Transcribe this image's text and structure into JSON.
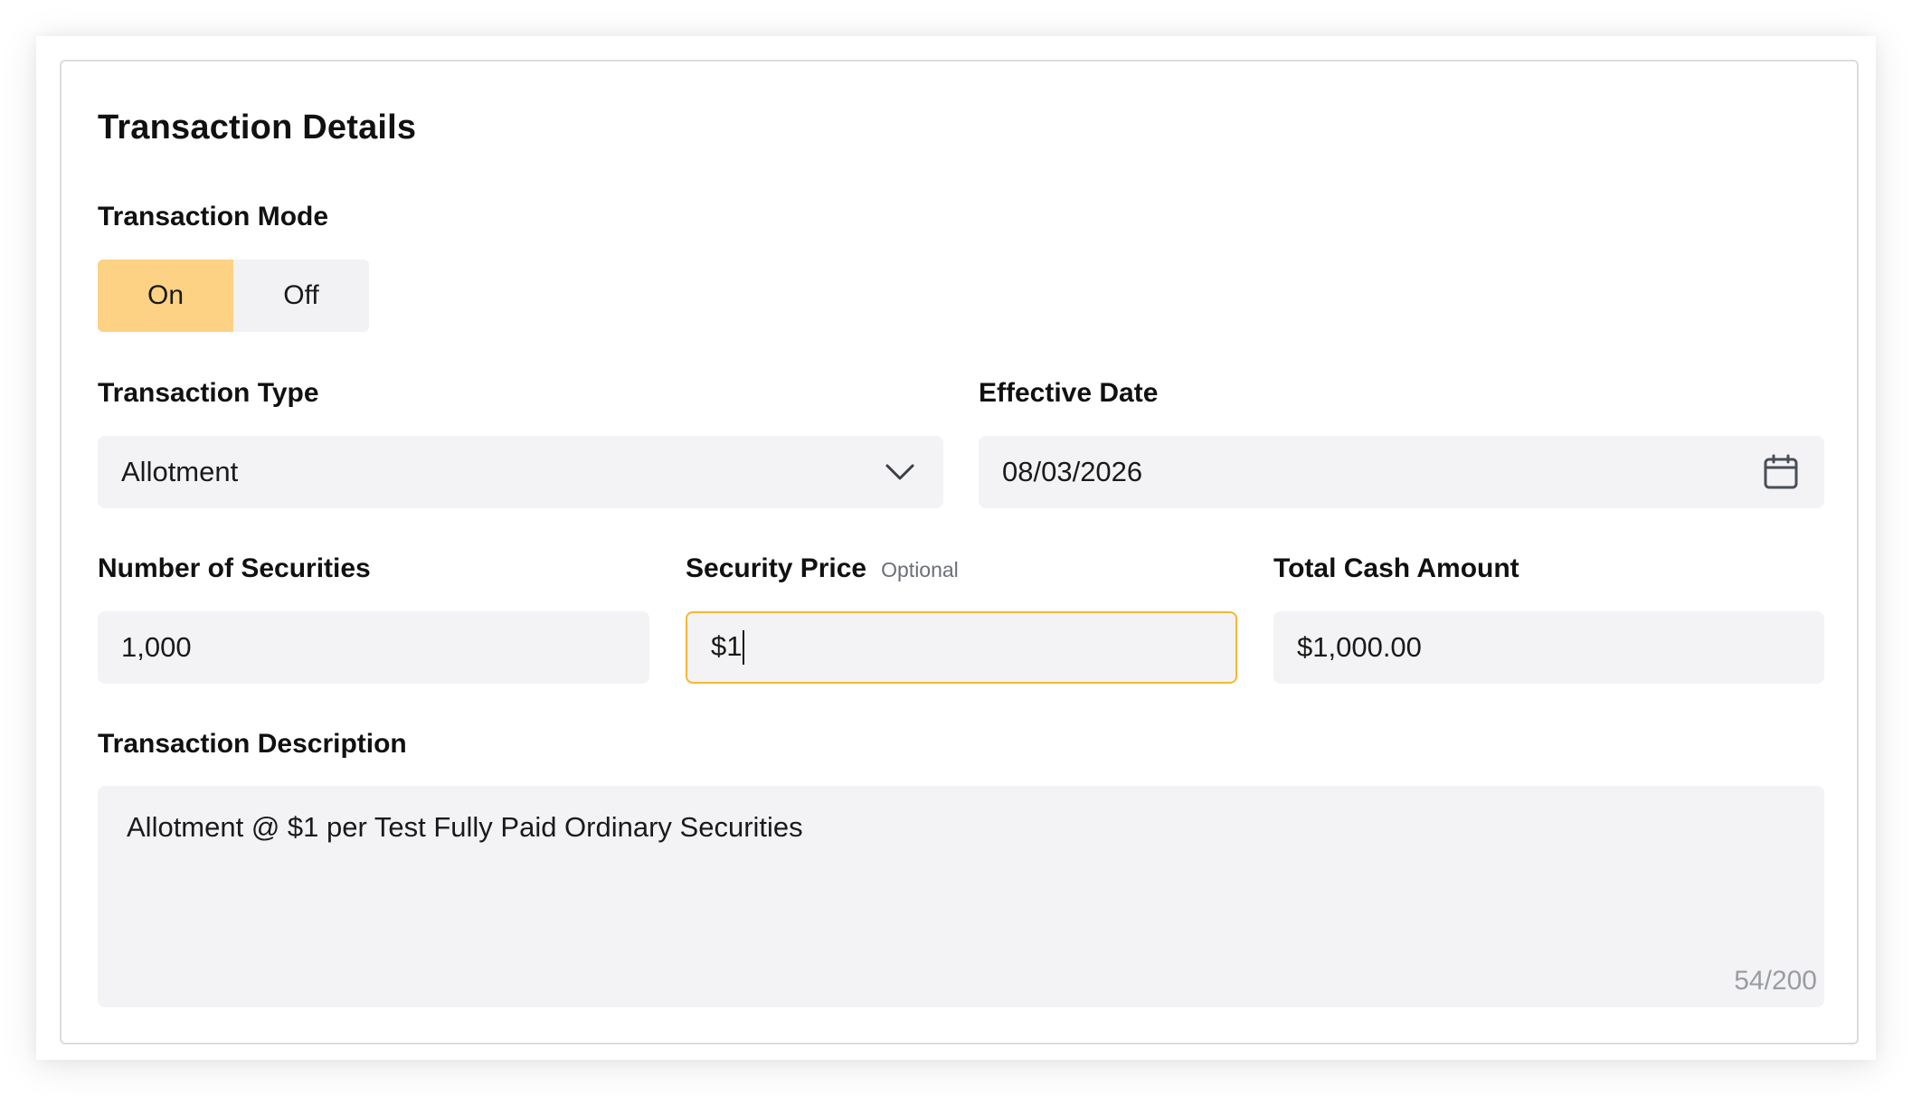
{
  "form": {
    "title": "Transaction Details",
    "mode": {
      "label": "Transaction Mode",
      "options": [
        "On",
        "Off"
      ],
      "selected": "On"
    },
    "type": {
      "label": "Transaction Type",
      "value": "Allotment"
    },
    "effective_date": {
      "label": "Effective Date",
      "value": "08/03/2026"
    },
    "number_of_securities": {
      "label": "Number of Securities",
      "value": "1,000"
    },
    "security_price": {
      "label": "Security Price",
      "optional_tag": "Optional",
      "value": "$1"
    },
    "total_cash_amount": {
      "label": "Total Cash Amount",
      "value": "$1,000.00"
    },
    "description": {
      "label": "Transaction Description",
      "value": "Allotment @ $1 per Test Fully Paid Ordinary Securities",
      "counter": "54/200"
    }
  },
  "icons": {
    "dropdown": "chevron-down-icon",
    "date": "calendar-icon"
  },
  "colors": {
    "toggle_active": "#fdd284",
    "focus_border": "#f3b833",
    "field_bg": "#f3f3f5",
    "muted_text": "#9a9ca3"
  }
}
